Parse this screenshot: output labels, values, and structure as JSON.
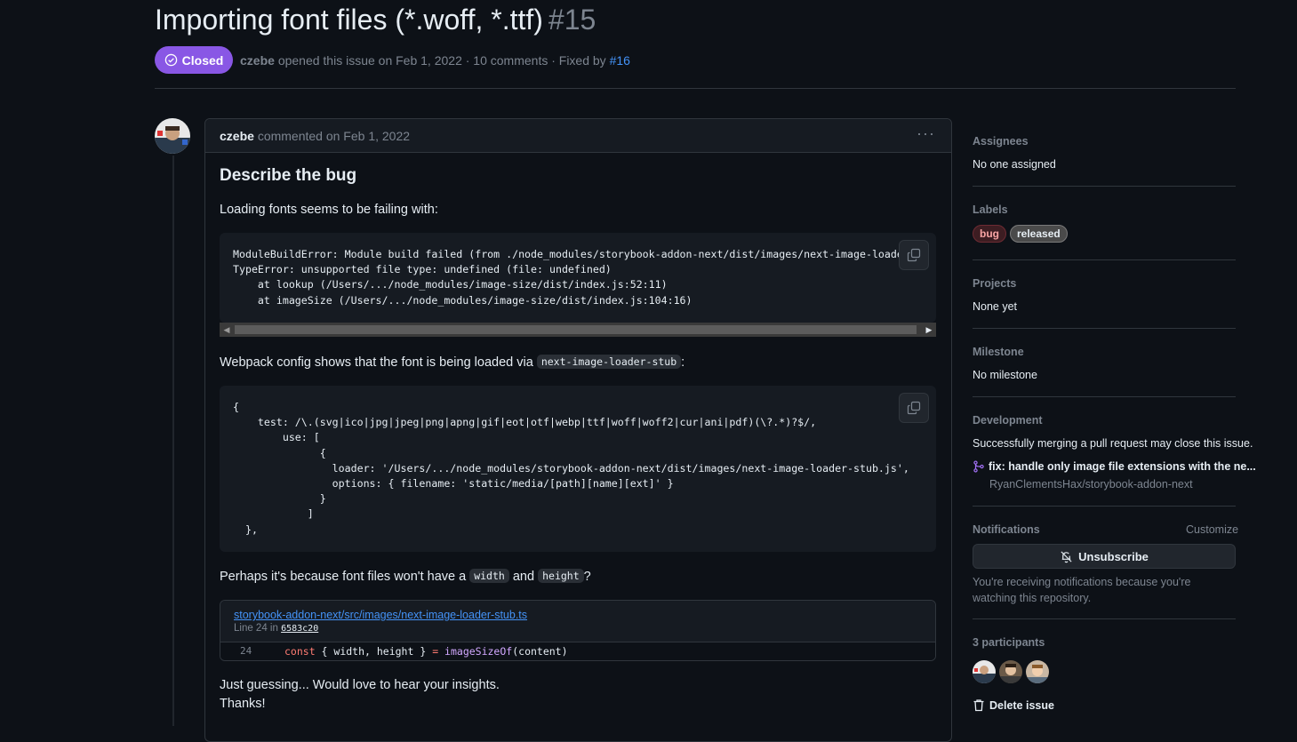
{
  "issue": {
    "title": "Importing font files (*.woff, *.ttf)",
    "number": "#15",
    "state": "Closed",
    "author": "czebe",
    "meta_text": "opened this issue on Feb 1, 2022 · 10 comments · Fixed by",
    "fixed_by": "#16"
  },
  "comment": {
    "author": "czebe",
    "commented_on": "commented on Feb 1, 2022",
    "heading": "Describe the bug",
    "p1": "Loading fonts seems to be failing with:",
    "code1": "ModuleBuildError: Module build failed (from ./node_modules/storybook-addon-next/dist/images/next-image-loader-stub.js):\nTypeError: unsupported file type: undefined (file: undefined)\n    at lookup (/Users/.../node_modules/image-size/dist/index.js:52:11)\n    at imageSize (/Users/.../node_modules/image-size/dist/index.js:104:16)",
    "p2_before": "Webpack config shows that the font is being loaded via",
    "p2_code": "next-image-loader-stub",
    "p2_after": ":",
    "code2": "{\n    test: /\\.(svg|ico|jpg|jpeg|png|apng|gif|eot|otf|webp|ttf|woff|woff2|cur|ani|pdf)(\\?.*)?$/,\n        use: [\n              {\n                loader: '/Users/.../node_modules/storybook-addon-next/dist/images/next-image-loader-stub.js',\n                options: { filename: 'static/media/[path][name][ext]' }\n              }\n            ]\n  },",
    "p3_before": "Perhaps it's because font files won't have a",
    "p3_code1": "width",
    "p3_and": "and",
    "p3_code2": "height",
    "p3_after": "?",
    "permalink": {
      "path": "storybook-addon-next/src/images/next-image-loader-stub.ts",
      "line_prefix": "Line 24 in",
      "sha": "6583c20",
      "line_number": "24",
      "code_kw": "const",
      "code_mid": " { width, height } ",
      "code_eq": "=",
      "code_fn": " imageSizeOf",
      "code_end": "(content)"
    },
    "p4": "Just guessing... Would love to hear your insights.",
    "p5": "Thanks!"
  },
  "sidebar": {
    "assignees_label": "Assignees",
    "assignees_value": "No one assigned",
    "labels_label": "Labels",
    "labels": [
      "bug",
      "released"
    ],
    "projects_label": "Projects",
    "projects_value": "None yet",
    "milestone_label": "Milestone",
    "milestone_value": "No milestone",
    "development_label": "Development",
    "development_note": "Successfully merging a pull request may close this issue.",
    "dev_pr_title": "fix: handle only image file extensions with the ne...",
    "dev_pr_repo": "RyanClementsHax/storybook-addon-next",
    "notifications_label": "Notifications",
    "customize": "Customize",
    "unsubscribe": "Unsubscribe",
    "notif_note": "You're receiving notifications because you're watching this repository.",
    "participants_label": "3 participants",
    "delete_issue": "Delete issue"
  },
  "colors": {
    "closed_badge": "#8957e5",
    "link": "#4493f8",
    "background": "#0d1117"
  }
}
